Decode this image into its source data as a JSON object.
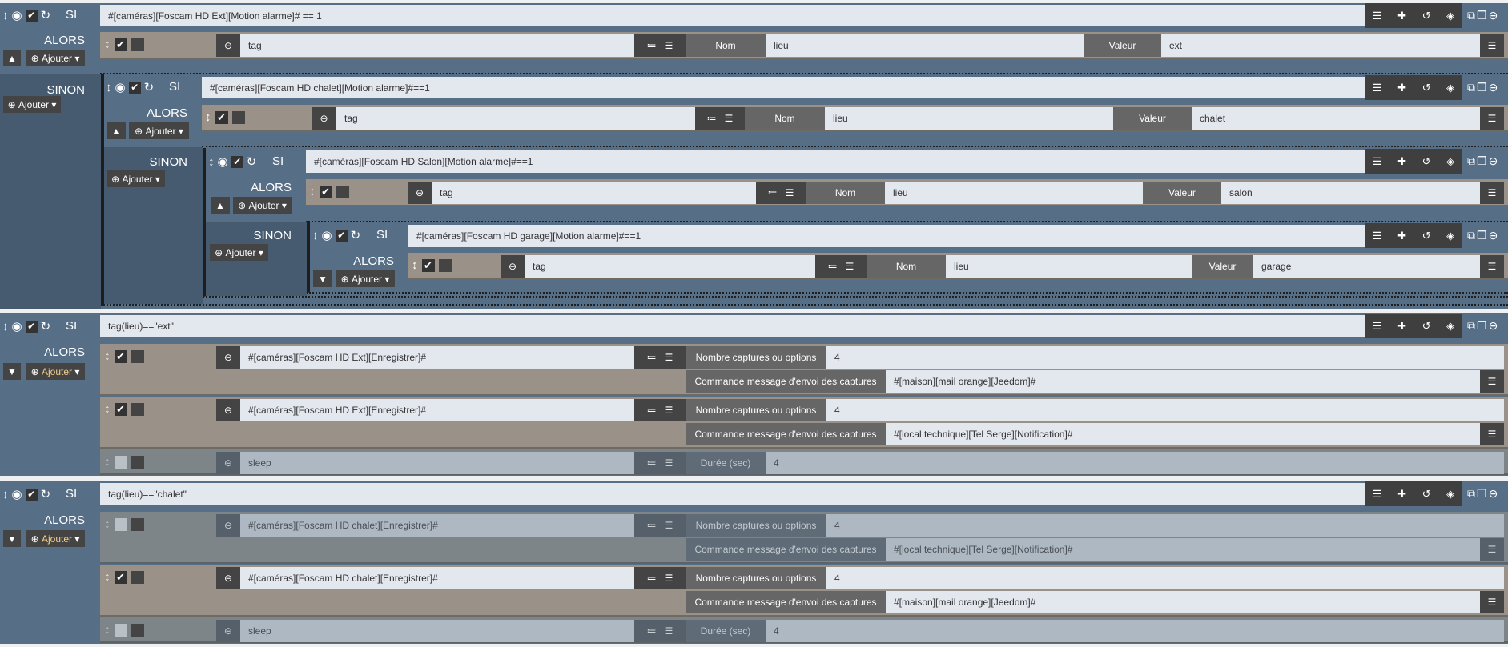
{
  "labels": {
    "si": "SI",
    "alors": "ALORS",
    "sinon": "SINON",
    "ajouter": "Ajouter",
    "nom": "Nom",
    "valeur": "Valeur",
    "nb": "Nombre captures ou options",
    "cmd": "Commande message d'envoi des captures",
    "duree": "Durée (sec)"
  },
  "b1": {
    "cond": "#[caméras][Foscam HD Ext][Motion alarme]# == 1",
    "act": {
      "cmd": "tag",
      "nom": "lieu",
      "val": "ext"
    }
  },
  "b2": {
    "cond": "#[caméras][Foscam HD chalet][Motion alarme]#==1",
    "act": {
      "cmd": "tag",
      "nom": "lieu",
      "val": "chalet"
    }
  },
  "b3": {
    "cond": "#[caméras][Foscam HD Salon][Motion alarme]#==1",
    "act": {
      "cmd": "tag",
      "nom": "lieu",
      "val": "salon"
    }
  },
  "b4": {
    "cond": "#[caméras][Foscam HD garage][Motion alarme]#==1",
    "act": {
      "cmd": "tag",
      "nom": "lieu",
      "val": "garage"
    }
  },
  "b5": {
    "cond": "tag(lieu)==\"ext\"",
    "a1": {
      "cmd": "#[caméras][Foscam HD Ext][Enregistrer]#",
      "nb": "4",
      "msg": "#[maison][mail orange][Jeedom]#",
      "enabled": true
    },
    "a2": {
      "cmd": "#[caméras][Foscam HD Ext][Enregistrer]#",
      "nb": "4",
      "msg": "#[local technique][Tel Serge][Notification]#",
      "enabled": true
    },
    "a3": {
      "cmd": "sleep",
      "duree": "4",
      "enabled": false
    }
  },
  "b6": {
    "cond": "tag(lieu)==\"chalet\"",
    "a1": {
      "cmd": "#[caméras][Foscam HD chalet][Enregistrer]#",
      "nb": "4",
      "msg": "#[local technique][Tel Serge][Notification]#",
      "enabled": false
    },
    "a2": {
      "cmd": "#[caméras][Foscam HD chalet][Enregistrer]#",
      "nb": "4",
      "msg": "#[maison][mail orange][Jeedom]#",
      "enabled": true
    },
    "a3": {
      "cmd": "sleep",
      "duree": "4",
      "enabled": false
    }
  }
}
